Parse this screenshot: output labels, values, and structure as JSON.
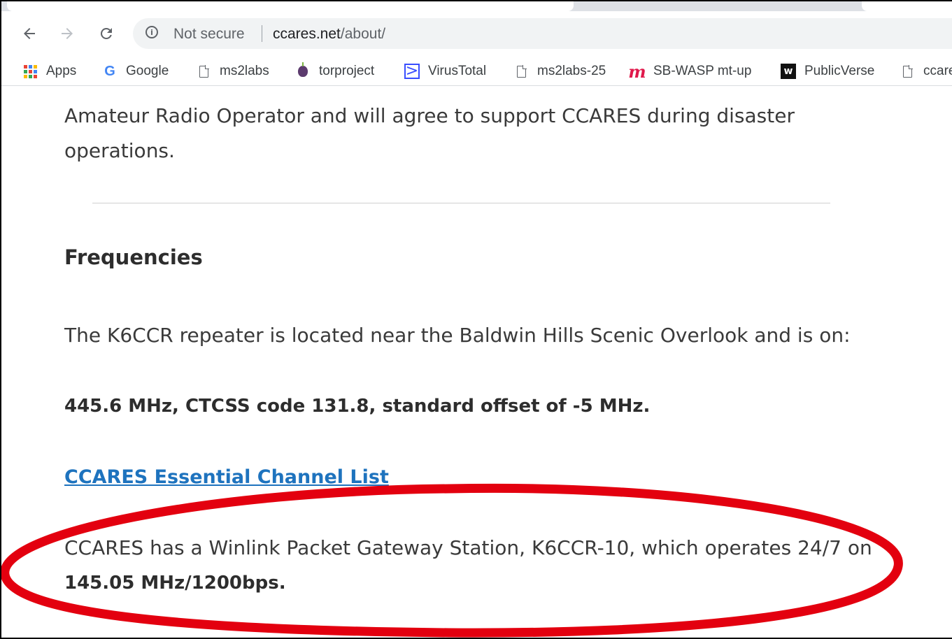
{
  "browser": {
    "nav": {
      "back_icon": "back-arrow-icon",
      "forward_icon": "forward-arrow-icon",
      "reload_icon": "reload-icon"
    },
    "omnibox": {
      "security_label": "Not secure",
      "url_host": "ccares.net",
      "url_path": "/about/"
    }
  },
  "bookmarks": [
    {
      "label": "Apps",
      "icon": "apps-grid-icon"
    },
    {
      "label": "Google",
      "icon": "google-icon"
    },
    {
      "label": "ms2labs",
      "icon": "page-icon"
    },
    {
      "label": "torproject",
      "icon": "tor-onion-icon"
    },
    {
      "label": "VirusTotal",
      "icon": "virustotal-icon"
    },
    {
      "label": "ms2labs-25",
      "icon": "page-icon"
    },
    {
      "label": "SB-WASP mt-up",
      "icon": "m-logo-icon"
    },
    {
      "label": "PublicVerse",
      "icon": "w-logo-icon"
    },
    {
      "label": "ccare",
      "icon": "page-icon"
    }
  ],
  "page": {
    "intro_line1": "Amateur Radio Operator and will agree to support CCARES during disaster",
    "intro_line2": "operations.",
    "heading": "Frequencies",
    "repeater_text": "The K6CCR repeater is located near the Baldwin Hills Scenic Overlook and is on:",
    "repeater_freq": "445.6 MHz, CTCSS code 131.8, standard offset of -5 MHz.",
    "channel_link": "CCARES Essential Channel List",
    "winlink_text": "CCARES has a Winlink Packet Gateway Station, K6CCR-10, which operates 24/7 on",
    "winlink_freq": "145.05 MHz/1200bps."
  },
  "annotation": {
    "color": "#e3000f"
  }
}
